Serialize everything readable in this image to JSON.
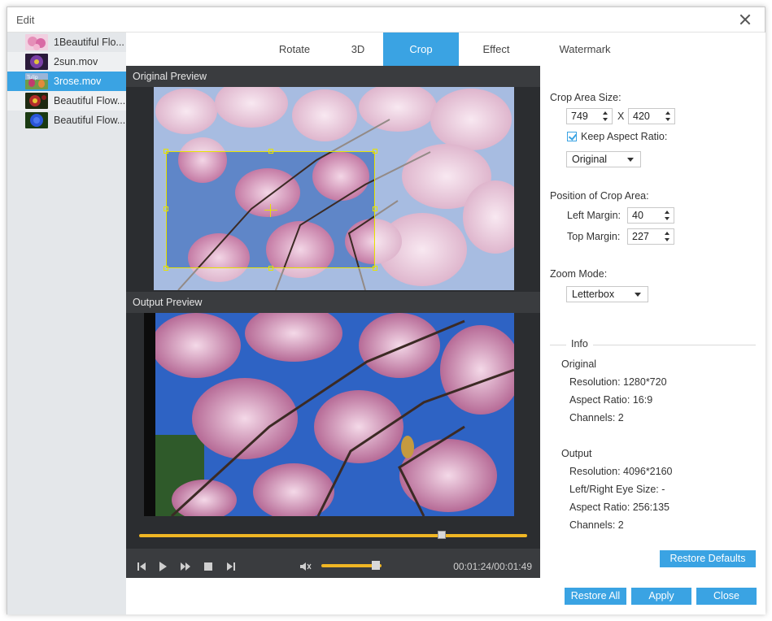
{
  "window": {
    "title": "Edit"
  },
  "files": [
    {
      "name": "1Beautiful Flo...",
      "thumb": "pink-flower"
    },
    {
      "name": "2sun.mov",
      "thumb": "purple-flower"
    },
    {
      "name": "3rose.mov",
      "thumb": "tulip",
      "thumb_text": "Tulip"
    },
    {
      "name": "Beautiful Flow...",
      "thumb": "red-yellow-flower"
    },
    {
      "name": "Beautiful Flow...",
      "thumb": "blue-flower"
    }
  ],
  "tabs": [
    "Rotate",
    "3D",
    "Crop",
    "Effect",
    "Watermark"
  ],
  "active_tab": "Crop",
  "preview": {
    "original_label": "Original Preview",
    "output_label": "Output Preview",
    "timecode": "00:01:24/00:01:49",
    "progress": 0.78,
    "volume": 0.9
  },
  "crop": {
    "area_size_label": "Crop Area Size:",
    "width": "749",
    "x_label": "X",
    "height": "420",
    "keep_aspect_label": "Keep Aspect Ratio:",
    "keep_aspect_checked": true,
    "aspect_option": "Original",
    "position_label": "Position of Crop Area:",
    "left_margin_label": "Left Margin:",
    "left_margin": "40",
    "top_margin_label": "Top Margin:",
    "top_margin": "227",
    "zoom_mode_label": "Zoom Mode:",
    "zoom_mode": "Letterbox"
  },
  "info": {
    "title": "Info",
    "original": {
      "heading": "Original",
      "resolution": "Resolution: 1280*720",
      "aspect": "Aspect Ratio: 16:9",
      "channels": "Channels: 2"
    },
    "output": {
      "heading": "Output",
      "resolution": "Resolution: 4096*2160",
      "eye_size": "Left/Right Eye Size: -",
      "aspect": "Aspect Ratio: 256:135",
      "channels": "Channels: 2"
    }
  },
  "buttons": {
    "restore_defaults": "Restore Defaults",
    "restore_all": "Restore All",
    "apply": "Apply",
    "close": "Close"
  },
  "colors": {
    "accent": "#3aa3e3",
    "timeline": "#f0b624",
    "crop_frame": "#e7e300"
  }
}
